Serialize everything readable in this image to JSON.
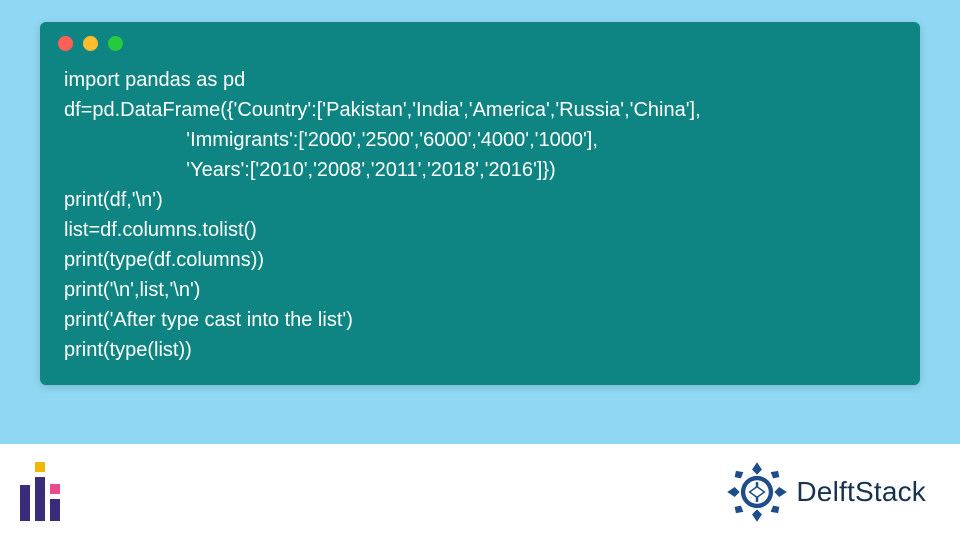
{
  "colors": {
    "page_bg": "#8fd7f2",
    "window_bg": "#0e8582",
    "code_fg": "#ffffff",
    "dot_red": "#ff5f56",
    "dot_yellow": "#ffbd2e",
    "dot_green": "#27c93f",
    "brand_navy": "#1f4d8a",
    "brand_purple": "#3a2b7b",
    "brand_yellow": "#f2b705",
    "brand_pink": "#e84a8a",
    "footer_bg": "#ffffff"
  },
  "code": {
    "lines": [
      "import pandas as pd",
      "df=pd.DataFrame({'Country':['Pakistan','India','America','Russia','China'],",
      "                      'Immigrants':['2000','2500','6000','4000','1000'],",
      "                      'Years':['2010','2008','2011','2018','2016']})",
      "print(df,'\\n')",
      "list=df.columns.tolist()",
      "print(type(df.columns))",
      "print('\\n',list,'\\n')",
      "print('After type cast into the list')",
      "print(type(list))"
    ]
  },
  "brand": {
    "name": "DelftStack"
  }
}
